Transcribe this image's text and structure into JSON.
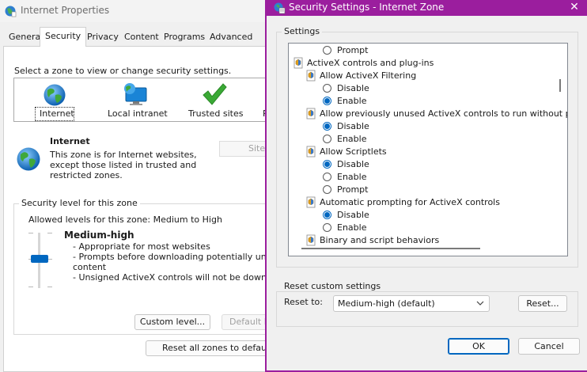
{
  "internet_properties": {
    "title": "Internet Properties",
    "tabs": [
      {
        "label": "General"
      },
      {
        "label": "Security"
      },
      {
        "label": "Privacy"
      },
      {
        "label": "Content"
      },
      {
        "label": "Programs"
      },
      {
        "label": "Advanced"
      }
    ],
    "active_tab": "Security",
    "zone_instruction": "Select a zone to view or change security settings.",
    "zones": [
      {
        "label": "Internet",
        "icon": "globe-icon"
      },
      {
        "label": "Local intranet",
        "icon": "monitor-globe-icon"
      },
      {
        "label": "Trusted sites",
        "icon": "checkmark-icon"
      },
      {
        "label": "R",
        "icon": "restricted-icon"
      }
    ],
    "zone_info": {
      "title": "Internet",
      "description": "This zone is for Internet websites, except those listed in trusted and restricted zones."
    },
    "sites_button": "Sites",
    "security_level": {
      "group_label": "Security level for this zone",
      "allowed_levels": "Allowed levels for this zone: Medium to High",
      "level_name": "Medium-high",
      "bullets": [
        "- Appropriate for most websites",
        "- Prompts before downloading potentially unsafe",
        "content",
        "- Unsigned ActiveX controls will not be downloaded"
      ],
      "custom_level_button": "Custom level...",
      "default_level_button": "Default le"
    },
    "reset_all_button": "Reset all zones to default le"
  },
  "security_settings": {
    "title": "Security Settings - Internet Zone",
    "close_glyph": "✕",
    "settings_label": "Settings",
    "list": [
      {
        "type": "option",
        "label": "Prompt",
        "checked": false,
        "indent": 2
      },
      {
        "type": "category",
        "label": "ActiveX controls and plug-ins",
        "indent": 0
      },
      {
        "type": "setting",
        "label": "Allow ActiveX Filtering",
        "indent": 1
      },
      {
        "type": "option",
        "label": "Disable",
        "checked": false,
        "indent": 2
      },
      {
        "type": "option",
        "label": "Enable",
        "checked": true,
        "indent": 2
      },
      {
        "type": "setting",
        "label": "Allow previously unused ActiveX controls to run without prom",
        "indent": 1
      },
      {
        "type": "option",
        "label": "Disable",
        "checked": true,
        "indent": 2
      },
      {
        "type": "option",
        "label": "Enable",
        "checked": false,
        "indent": 2
      },
      {
        "type": "setting",
        "label": "Allow Scriptlets",
        "indent": 1
      },
      {
        "type": "option",
        "label": "Disable",
        "checked": true,
        "indent": 2
      },
      {
        "type": "option",
        "label": "Enable",
        "checked": false,
        "indent": 2
      },
      {
        "type": "option",
        "label": "Prompt",
        "checked": false,
        "indent": 2
      },
      {
        "type": "setting",
        "label": "Automatic prompting for ActiveX controls",
        "indent": 1
      },
      {
        "type": "option",
        "label": "Disable",
        "checked": true,
        "indent": 2
      },
      {
        "type": "option",
        "label": "Enable",
        "checked": false,
        "indent": 2
      },
      {
        "type": "setting",
        "label": "Binary and script behaviors",
        "indent": 1
      }
    ],
    "reset_group_label": "Reset custom settings",
    "reset_to_label": "Reset to:",
    "reset_to_value": "Medium-high (default)",
    "reset_button": "Reset...",
    "ok_button": "OK",
    "cancel_button": "Cancel"
  },
  "colors": {
    "accent": "#0067c0",
    "dialog_border": "#9b1e9e",
    "check_green": "#3aa935"
  }
}
